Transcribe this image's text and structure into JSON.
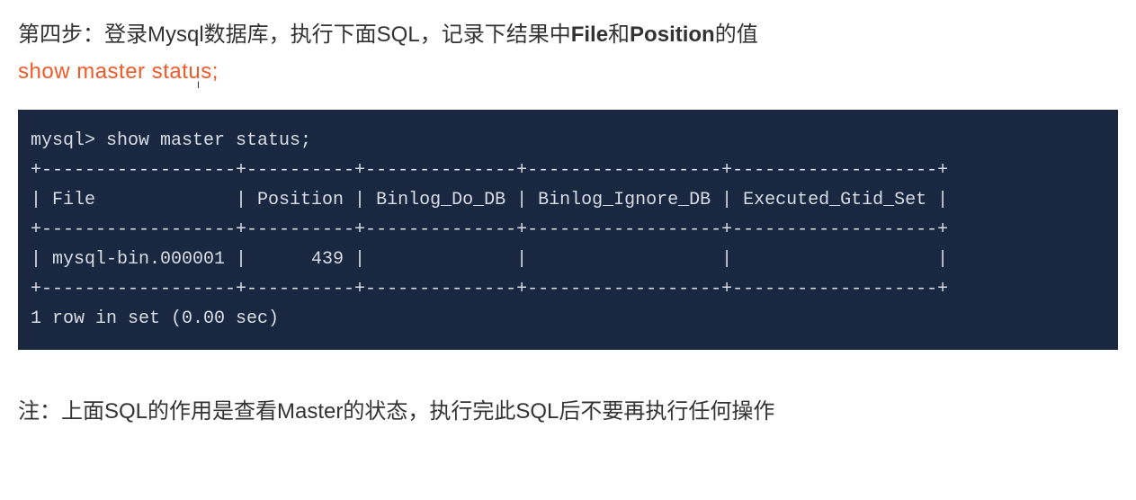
{
  "heading": {
    "prefix": "第四步：登录Mysql数据库，执行下面SQL，记录下结果中",
    "bold1": "File",
    "mid": "和",
    "bold2": "Position",
    "suffix": "的值"
  },
  "sql_command": "show master status;",
  "cursor_glyph": "I",
  "terminal": {
    "prompt_line": "mysql> show master status;",
    "sep_top": "+------------------+----------+--------------+------------------+-------------------+",
    "header_row": "| File             | Position | Binlog_Do_DB | Binlog_Ignore_DB | Executed_Gtid_Set |",
    "sep_mid": "+------------------+----------+--------------+------------------+-------------------+",
    "data_row": "| mysql-bin.000001 |      439 |              |                  |                   |",
    "sep_bot": "+------------------+----------+--------------+------------------+-------------------+",
    "footer": "1 row in set (0.00 sec)"
  },
  "note": "注：上面SQL的作用是查看Master的状态，执行完此SQL后不要再执行任何操作",
  "chart_data": {
    "type": "table",
    "title": "show master status",
    "columns": [
      "File",
      "Position",
      "Binlog_Do_DB",
      "Binlog_Ignore_DB",
      "Executed_Gtid_Set"
    ],
    "rows": [
      {
        "File": "mysql-bin.000001",
        "Position": 439,
        "Binlog_Do_DB": "",
        "Binlog_Ignore_DB": "",
        "Executed_Gtid_Set": ""
      }
    ],
    "row_count": 1,
    "elapsed_sec": 0.0
  }
}
